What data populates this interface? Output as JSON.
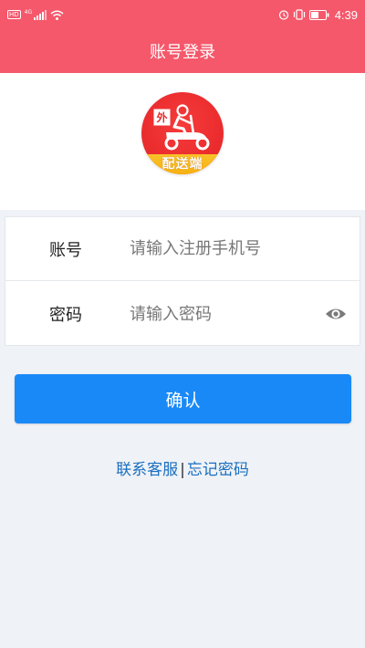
{
  "status_bar": {
    "hd": "HD",
    "net": "4G",
    "time": "4:39"
  },
  "header": {
    "title": "账号登录"
  },
  "logo": {
    "badge_char": "外",
    "caption": "配送端"
  },
  "form": {
    "account": {
      "label": "账号",
      "placeholder": "请输入注册手机号",
      "value": ""
    },
    "password": {
      "label": "密码",
      "placeholder": "请输入密码",
      "value": ""
    }
  },
  "actions": {
    "confirm_label": "确认",
    "contact_label": "联系客服",
    "separator": "|",
    "forgot_label": "忘记密码"
  },
  "colors": {
    "brand": "#f5586b",
    "primary_button": "#1a89f8",
    "link": "#1a6fc0",
    "logo_red": "#e92a2c",
    "logo_yellow": "#f9c12a"
  },
  "icons": [
    "alarm-icon",
    "vibrate-icon",
    "battery-icon",
    "signal-icon",
    "wifi-icon",
    "eye-icon",
    "scooter-rider-icon"
  ]
}
